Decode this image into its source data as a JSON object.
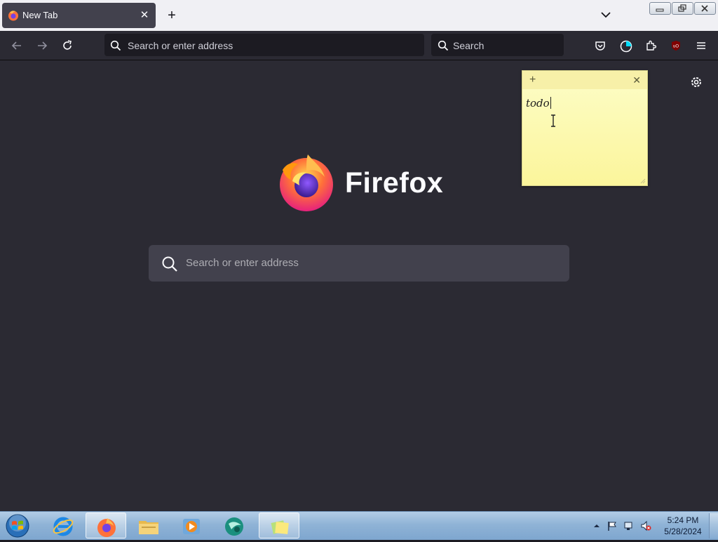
{
  "browser": {
    "tab": {
      "title": "New Tab",
      "close": "✕"
    },
    "new_tab_symbol": "+",
    "urlbar": {
      "placeholder": "Search or enter address"
    },
    "searchbar": {
      "placeholder": "Search"
    },
    "toolbar_icons": [
      "back-icon",
      "forward-icon",
      "reload-icon",
      "pocket-icon",
      "firefox-account-icon",
      "extensions-icon",
      "ublock-origin-icon",
      "menu-icon"
    ]
  },
  "newtab": {
    "brand": "Firefox",
    "search_placeholder": "Search or enter address"
  },
  "sticky_note": {
    "add": "+",
    "close": "✕",
    "text": "todo"
  },
  "taskbar": {
    "apps": [
      "internet-explorer",
      "firefox",
      "file-explorer",
      "media-player",
      "app-sphere",
      "sticky-notes"
    ],
    "time": "5:24 PM",
    "date": "5/28/2024"
  },
  "colors": {
    "tabstrip_bg": "#f0f0f4",
    "toolbar_bg": "#2b2a33",
    "field_bg": "#1c1b22",
    "note_bg": "#fdfdc7",
    "accent_firefox": "#ff7139"
  }
}
